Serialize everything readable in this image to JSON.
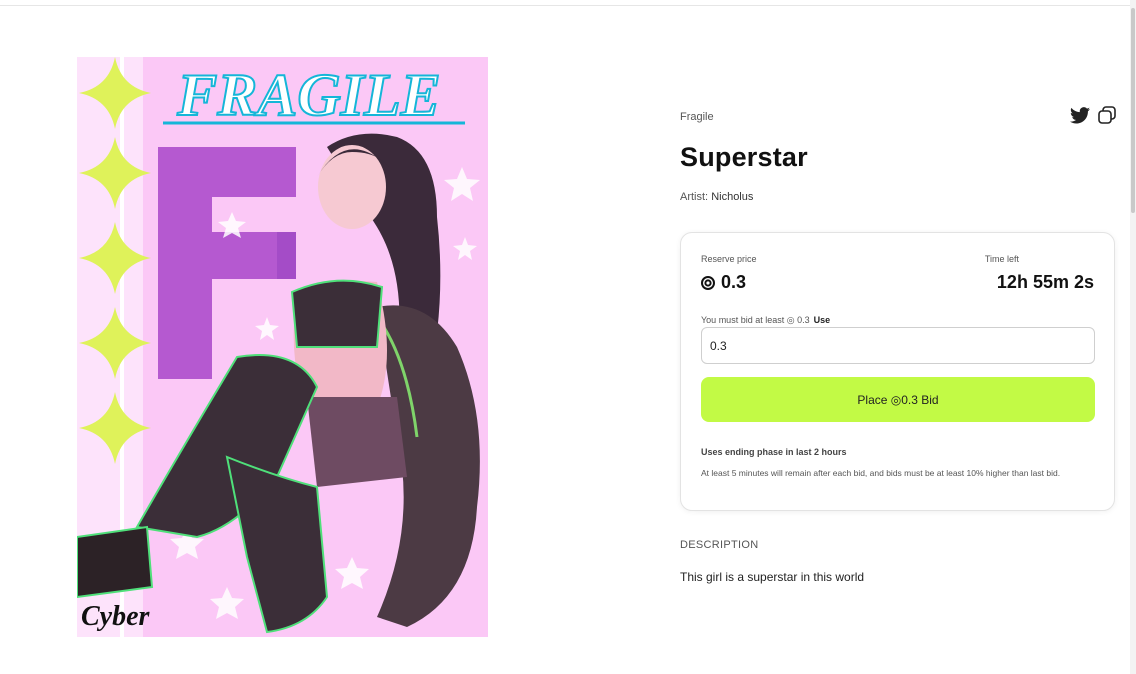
{
  "artwork": {
    "title_text": "FRAGILE",
    "logo_text": "Cyber"
  },
  "collection": "Fragile",
  "title": "Superstar",
  "artist_prefix": "Artist:",
  "artist": "Nicholus",
  "icons": {
    "share": "twitter-icon",
    "copy": "copy-link-icon",
    "expand": "expand-icon",
    "currency": "currency-icon"
  },
  "auction": {
    "reserve_label": "Reserve price",
    "reserve_value": "0.3",
    "time_label": "Time left",
    "time_value": "12h 55m 2s",
    "hint": "You must bid at least ◎ 0.3",
    "use_label": "Use",
    "input_value": "0.3",
    "button_label": "Place ◎0.3 Bid",
    "ending_title": "Uses ending phase in last 2 hours",
    "ending_text": "At least 5 minutes will remain after each bid, and bids must be at least 10% higher than last bid."
  },
  "description": {
    "heading": "DESCRIPTION",
    "text": "This girl is a superstar in this world"
  },
  "colors": {
    "accent": "#c2fa45",
    "art_bg": "#fbc8f6",
    "diamond": "#dff25a"
  }
}
